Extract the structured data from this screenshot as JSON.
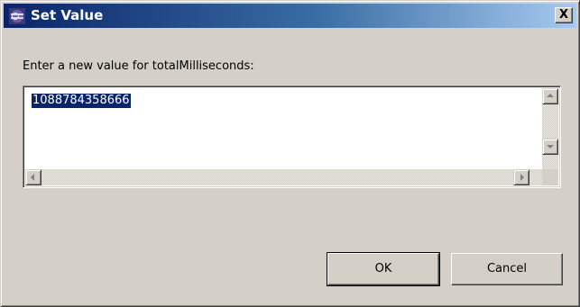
{
  "window": {
    "title": "Set Value",
    "close_glyph": "X",
    "icon": "app-icon"
  },
  "prompt": "Enter a new value for totalMilliseconds:",
  "value_field": {
    "value": "1088784358666",
    "selected": true
  },
  "buttons": {
    "ok_label": "OK",
    "cancel_label": "Cancel"
  },
  "colors": {
    "title_bar_start": "#0a246a",
    "title_bar_end": "#a6caf0",
    "dialog_face": "#d4d0c8",
    "selection": "#0a246a"
  }
}
